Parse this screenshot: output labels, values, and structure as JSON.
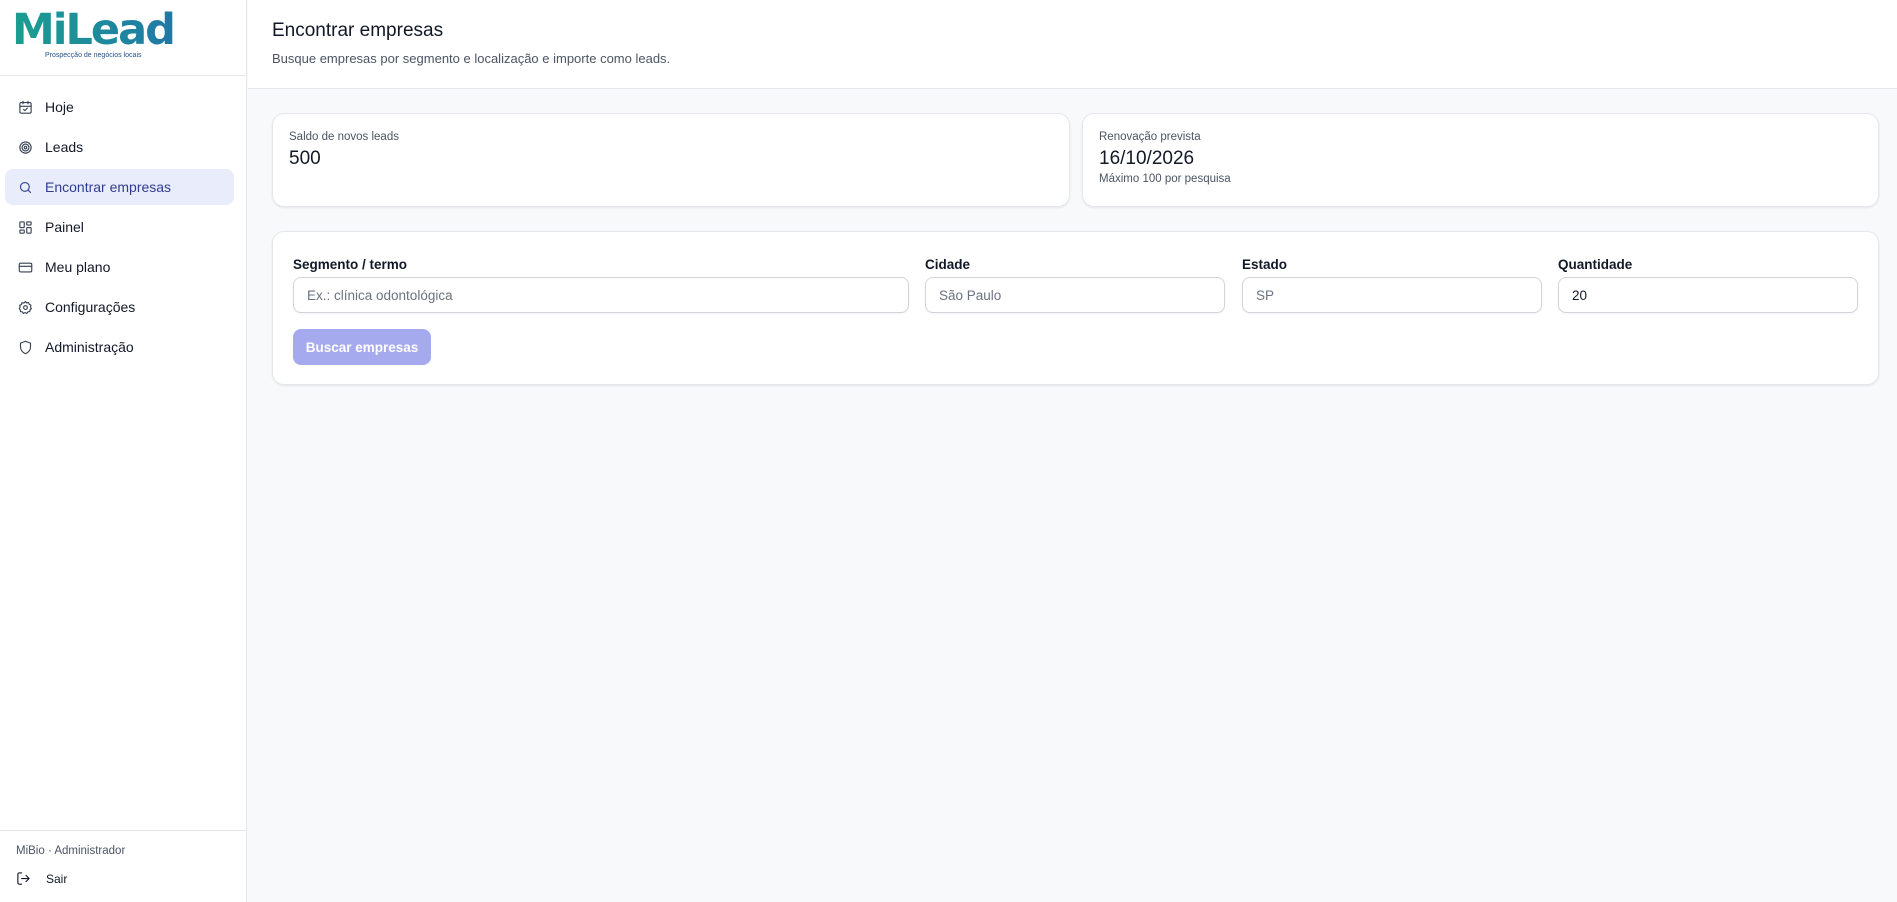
{
  "brand": {
    "logo_text": "MiLead",
    "tagline": "Prospecção de negócios locais"
  },
  "sidebar": {
    "items": [
      {
        "label": "Hoje",
        "icon": "calendar-check-icon"
      },
      {
        "label": "Leads",
        "icon": "target-icon"
      },
      {
        "label": "Encontrar empresas",
        "icon": "search-icon",
        "active": true
      },
      {
        "label": "Painel",
        "icon": "dashboard-grid-icon"
      },
      {
        "label": "Meu plano",
        "icon": "credit-card-icon"
      },
      {
        "label": "Configurações",
        "icon": "gear-icon"
      },
      {
        "label": "Administração",
        "icon": "shield-icon"
      }
    ],
    "footer": {
      "user": "MiBio · Administrador",
      "logout_label": "Sair"
    }
  },
  "header": {
    "title": "Encontrar empresas",
    "subtitle": "Busque empresas por segmento e localização e importe como leads."
  },
  "stats": {
    "balance_label": "Saldo de novos leads",
    "balance_value": "500",
    "renewal_label": "Renovação prevista",
    "renewal_value": "16/10/2026",
    "renewal_note": "Máximo 100 por pesquisa"
  },
  "search": {
    "segment_label": "Segmento / termo",
    "segment_placeholder": "Ex.: clínica odontológica",
    "segment_value": "",
    "city_label": "Cidade",
    "city_placeholder": "São Paulo",
    "city_value": "",
    "state_label": "Estado",
    "state_placeholder": "SP",
    "state_value": "",
    "quantity_label": "Quantidade",
    "quantity_value": "20",
    "button_label": "Buscar empresas"
  },
  "colors": {
    "accent": "#2f3d8f",
    "active_bg": "#e9ecfb",
    "button_disabled": "#a5aaee"
  }
}
